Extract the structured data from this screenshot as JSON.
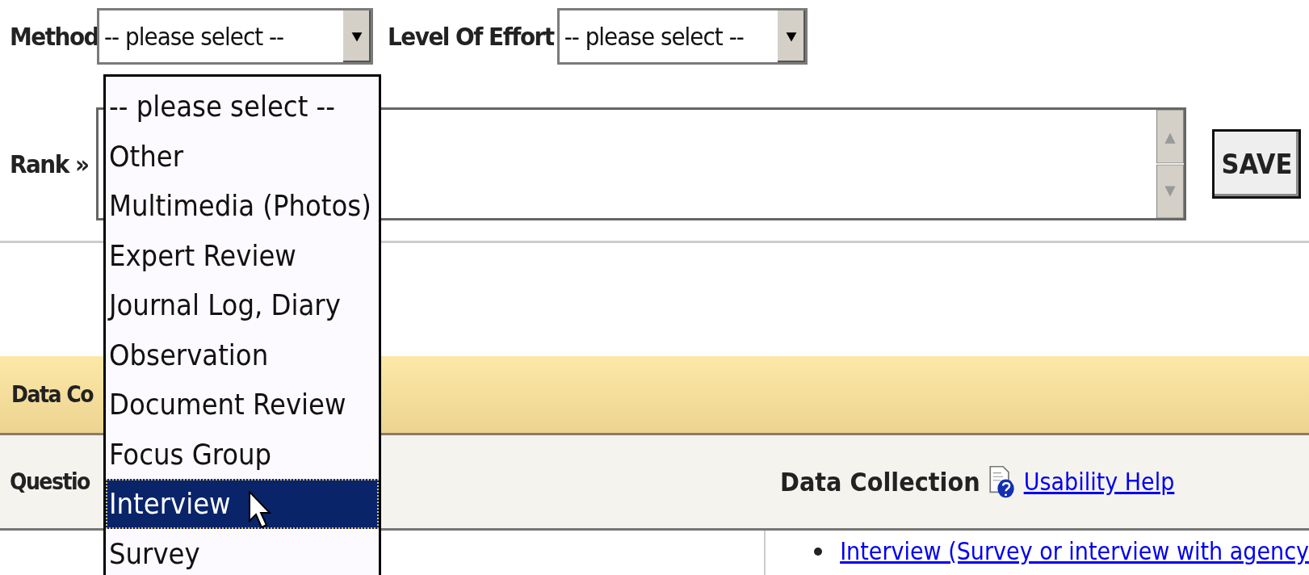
{
  "filters": [
    {
      "label": "Method",
      "value": "-- please select --"
    },
    {
      "label": "Level Of Effort",
      "value": "-- please select --"
    }
  ],
  "rank": {
    "label": "Rank »"
  },
  "save_button": "SAVE",
  "dropdown": {
    "options": [
      {
        "label": "-- please select --",
        "selected": false
      },
      {
        "label": "Other",
        "selected": false
      },
      {
        "label": "Multimedia (Photos)",
        "selected": false
      },
      {
        "label": "Expert Review",
        "selected": false
      },
      {
        "label": "Journal Log, Diary",
        "selected": false
      },
      {
        "label": "Observation",
        "selected": false
      },
      {
        "label": "Document Review",
        "selected": false
      },
      {
        "label": "Focus Group",
        "selected": false
      },
      {
        "label": "Interview",
        "selected": true
      },
      {
        "label": "Survey",
        "selected": false
      }
    ]
  },
  "section": {
    "title": "Data Co"
  },
  "table": {
    "columns": [
      {
        "label": "Questio"
      },
      {
        "label": "Data Collection",
        "help_link": "Usability Help"
      }
    ],
    "rows": [
      {
        "items": [
          "Interview (Survey or interview with agency"
        ]
      }
    ]
  }
}
